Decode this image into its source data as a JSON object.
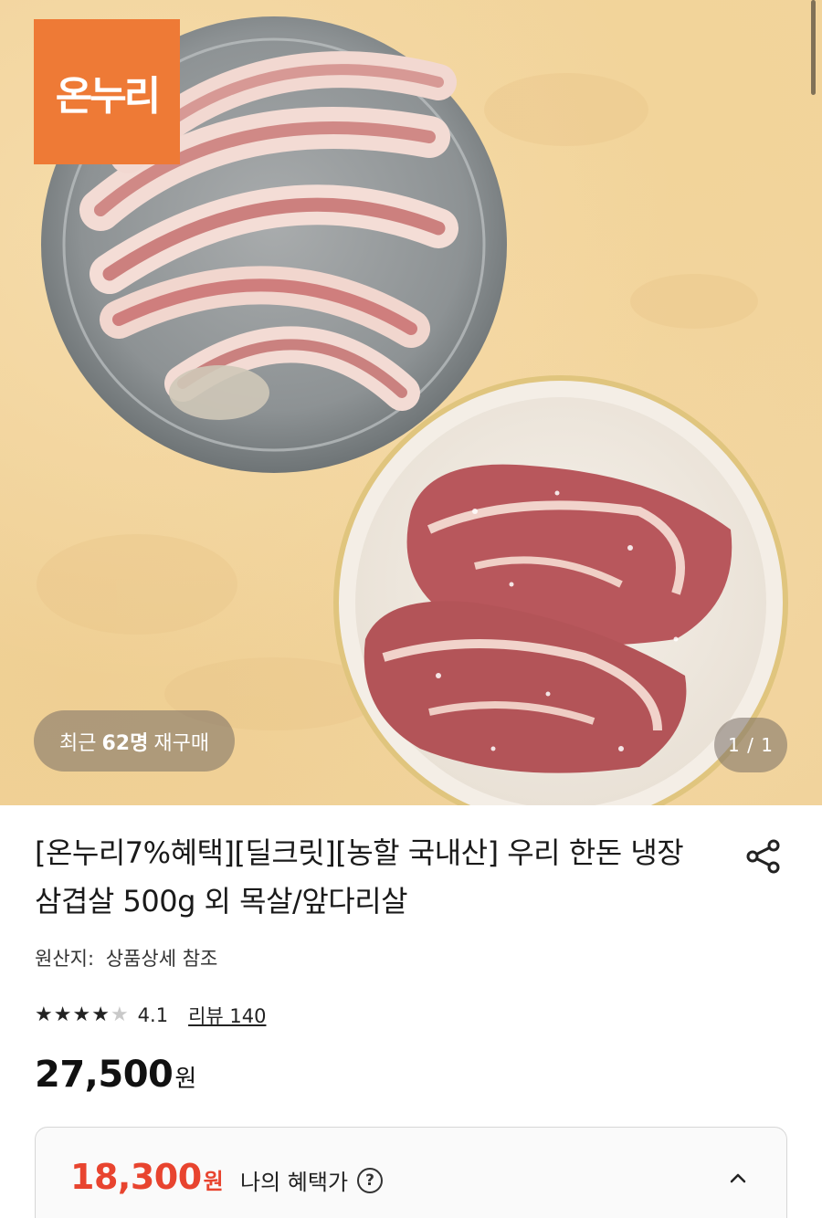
{
  "brand": {
    "logo_text": "온누리",
    "accent_color": "#ee7a36"
  },
  "hero": {
    "repurchase": {
      "prefix": "최근",
      "count": "62명",
      "suffix": "재구매"
    },
    "page_counter": "1 / 1"
  },
  "product": {
    "title": "[온누리7%혜택][딜크릿][농할 국내산] 우리 한돈 냉장 삼겹살 500g 외 목살/앞다리살",
    "origin_label": "원산지:",
    "origin_value": "상품상세 참조",
    "rating": {
      "stars_filled": 4,
      "stars_total": 5,
      "value": "4.1",
      "review_text": "리뷰 140"
    },
    "price": {
      "amount": "27,500",
      "unit": "원"
    },
    "benefit": {
      "amount": "18,300",
      "unit": "원",
      "label": "나의 혜택가",
      "help_icon": "?",
      "price_color": "#e8442f"
    }
  },
  "icons": {
    "share": "share-icon",
    "collapse": "chevron-up-icon",
    "help": "question-circle-icon",
    "star": "star-icon"
  }
}
